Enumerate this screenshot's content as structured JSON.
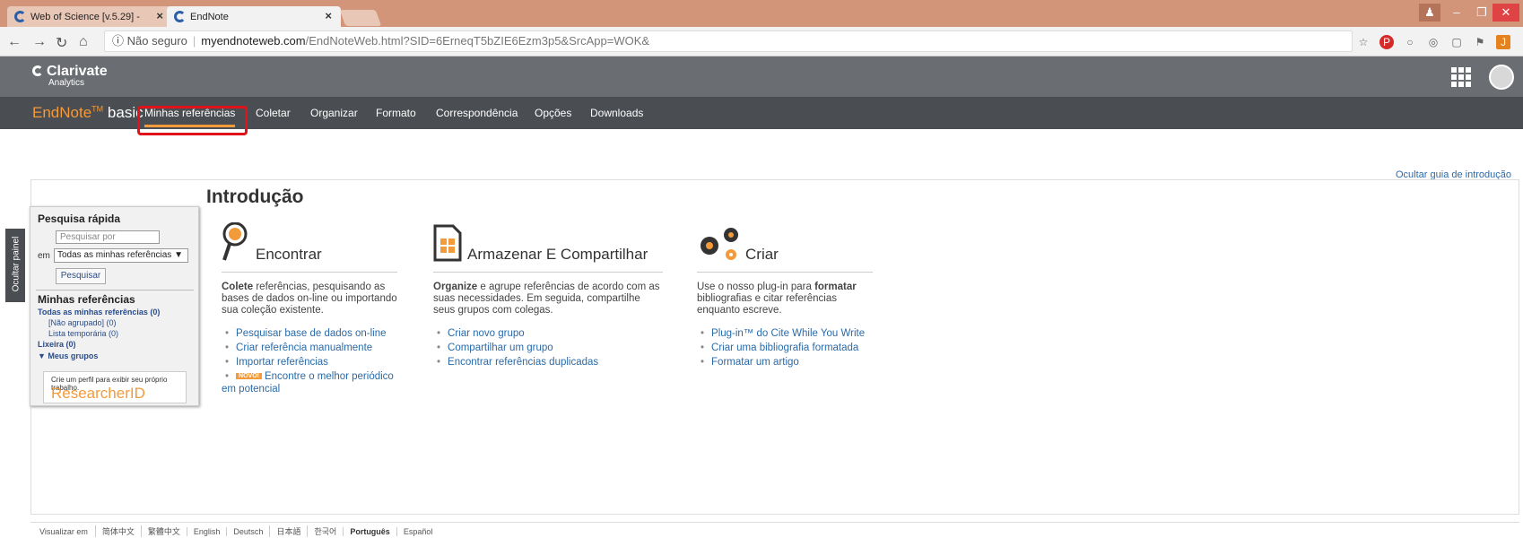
{
  "browser": {
    "tabs": [
      {
        "title": "Web of Science [v.5.29] -",
        "active": false
      },
      {
        "title": "EndNote",
        "active": true
      }
    ],
    "address": {
      "security": "Não seguro",
      "host": "myendnoteweb.com",
      "path": "/EndNoteWeb.html?SID=6ErneqT5bZIE6Ezm3p5&SrcApp=WOK&"
    }
  },
  "header": {
    "brand": "Clarivate",
    "brand_sub": "Analytics"
  },
  "endnote": {
    "brand": "EndNote",
    "tm": "TM",
    "edition": "basic",
    "nav": [
      "Minhas referências",
      "Coletar",
      "Organizar",
      "Formato",
      "Correspondência",
      "Opções",
      "Downloads"
    ]
  },
  "hide_guide": "Ocultar guia de introdução",
  "side_tab": "Ocultar painel",
  "quick": {
    "title": "Pesquisa rápida",
    "search_placeholder": "Pesquisar por",
    "em_label": "em",
    "scope": "Todas as minhas referências ▼",
    "search_button": "Pesquisar",
    "refs_title": "Minhas referências",
    "all_refs": "Todas as minhas referências (0)",
    "unfiled": "[Não agrupado] (0)",
    "temp_list": "Lista temporária (0)",
    "trash": "Lixeira (0)",
    "my_groups": "▼ Meus grupos",
    "profile_text": "Crie um perfil para exibir seu próprio trabalho.",
    "researcher_id": "ResearcherID"
  },
  "intro": {
    "title": "Introdução",
    "columns": [
      {
        "heading": "Encontrar",
        "desc_bold": "Colete",
        "desc": " referências, pesquisando as bases de dados on-line ou importando sua coleção existente.",
        "links": [
          "Pesquisar base de dados on-line",
          "Criar referência manualmente",
          "Importar referências"
        ],
        "badge": "NOVO!",
        "badge_link": "Encontre o melhor periódico",
        "badge_link_cont": "em potencial"
      },
      {
        "heading": "Armazenar E Compartilhar",
        "desc_bold": "Organize",
        "desc": " e agrupe referências de acordo com as suas necessidades. Em seguida, compartilhe seus grupos com colegas.",
        "links": [
          "Criar novo grupo",
          "Compartilhar um grupo",
          "Encontrar referências duplicadas"
        ]
      },
      {
        "heading": "Criar",
        "desc_pre": "Use o nosso plug-in para ",
        "desc_bold": "formatar",
        "desc": " bibliografias e citar referências enquanto escreve.",
        "links": [
          "Plug-in™ do Cite While You Write",
          "Criar uma bibliografia formatada",
          "Formatar um artigo"
        ]
      }
    ]
  },
  "footer": {
    "label": "Visualizar em",
    "languages": [
      "简体中文",
      "繁體中文",
      "English",
      "Deutsch",
      "日本語",
      "한국어",
      "Português",
      "Español"
    ]
  }
}
